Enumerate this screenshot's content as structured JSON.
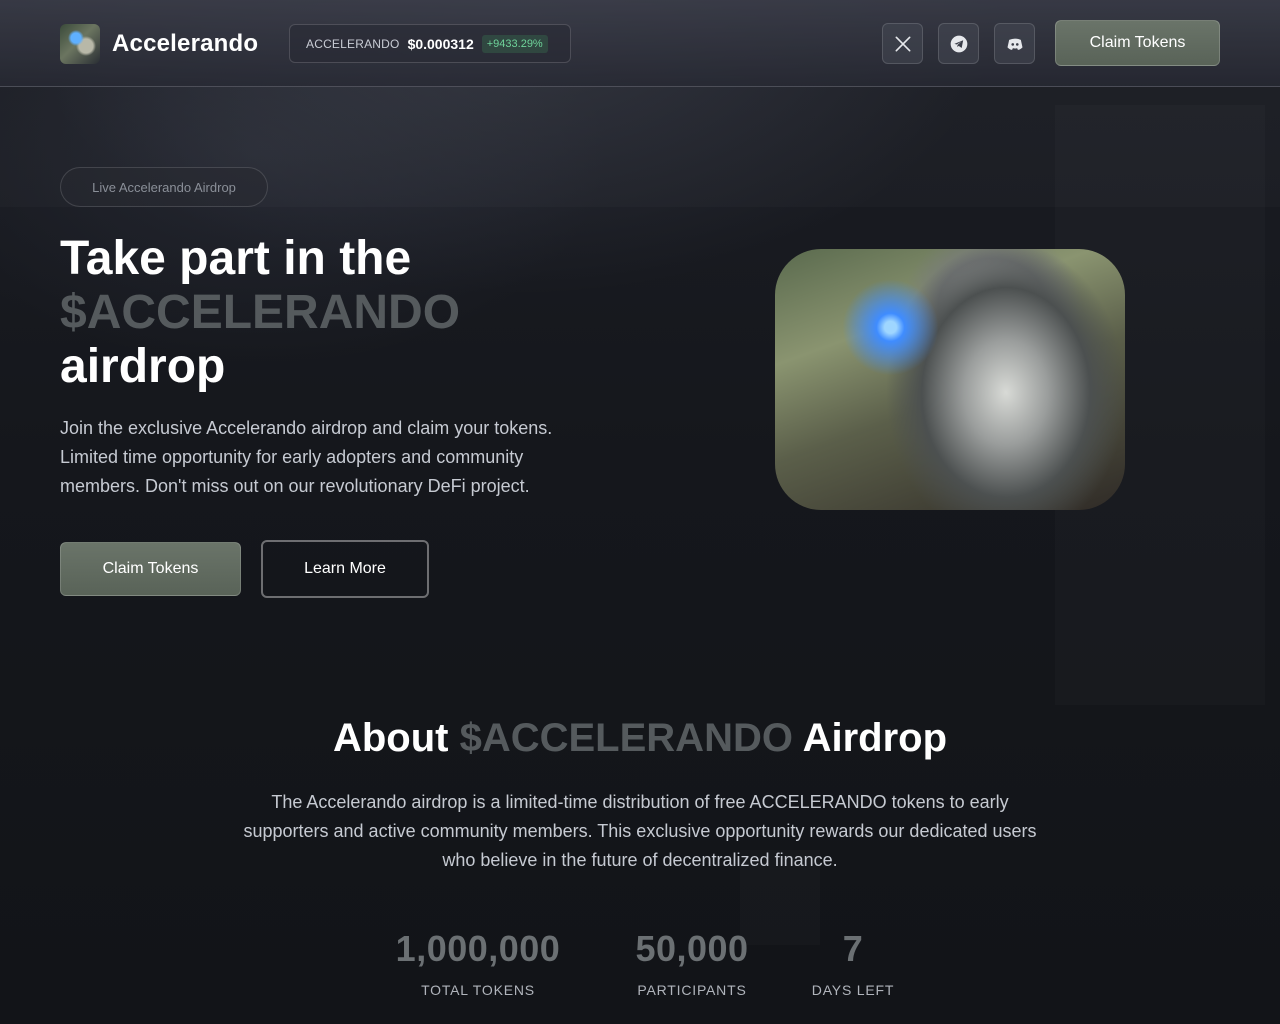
{
  "header": {
    "brand": "Accelerando",
    "ticker": {
      "symbol": "ACCELERANDO",
      "price": "$0.000312",
      "change": "+9433.29%"
    },
    "social": [
      "x-icon",
      "telegram-icon",
      "discord-icon"
    ],
    "claim_label": "Claim Tokens"
  },
  "hero": {
    "badge": "Live Accelerando Airdrop",
    "title_line1": "Take part in the",
    "title_accent": "$ACCELERANDO",
    "title_line3": "airdrop",
    "description": "Join the exclusive Accelerando airdrop and claim your tokens. Limited time opportunity for early adopters and community members. Don't miss out on our revolutionary DeFi project.",
    "claim_label": "Claim Tokens",
    "learn_label": "Learn More"
  },
  "about": {
    "title_prefix": "About",
    "title_accent": "$ACCELERANDO",
    "title_suffix": "Airdrop",
    "description": "The Accelerando airdrop is a limited-time distribution of free ACCELERANDO tokens to early supporters and active community members. This exclusive opportunity rewards our dedicated users who believe in the future of decentralized finance.",
    "stats": [
      {
        "value": "1,000,000",
        "label": "TOTAL TOKENS"
      },
      {
        "value": "50,000",
        "label": "PARTICIPANTS"
      },
      {
        "value": "7",
        "label": "DAYS LEFT"
      }
    ]
  },
  "colors": {
    "background": "#15171c",
    "accent_text": "#555a5d",
    "button": "#626c61",
    "positive": "#6fd39a"
  }
}
